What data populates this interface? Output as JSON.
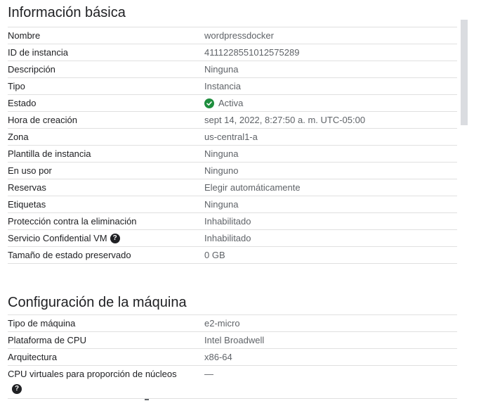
{
  "basic": {
    "title": "Información básica",
    "rows": [
      {
        "label": "Nombre",
        "value": "wordpressdocker"
      },
      {
        "label": "ID de instancia",
        "value": "4111228551012575289"
      },
      {
        "label": "Descripción",
        "value": "Ninguna"
      },
      {
        "label": "Tipo",
        "value": "Instancia"
      },
      {
        "label": "Estado",
        "value": "Activa"
      },
      {
        "label": "Hora de creación",
        "value": "sept 14, 2022, 8:27:50 a. m. UTC-05:00"
      },
      {
        "label": "Zona",
        "value": "us-central1-a"
      },
      {
        "label": "Plantilla de instancia",
        "value": "Ninguna"
      },
      {
        "label": "En uso por",
        "value": "Ninguno"
      },
      {
        "label": "Reservas",
        "value": "Elegir automáticamente"
      },
      {
        "label": "Etiquetas",
        "value": "Ninguna"
      },
      {
        "label": "Protección contra la eliminación",
        "value": "Inhabilitado"
      },
      {
        "label": "Servicio Confidential VM",
        "value": "Inhabilitado"
      },
      {
        "label": "Tamaño de estado preservado",
        "value": "0 GB"
      }
    ]
  },
  "machine": {
    "title": "Configuración de la máquina",
    "rows": [
      {
        "label": "Tipo de máquina",
        "value": "e2-micro"
      },
      {
        "label": "Plataforma de CPU",
        "value": "Intel Broadwell"
      },
      {
        "label": "Arquitectura",
        "value": "x86-64"
      },
      {
        "label": "CPU virtuales para proporción de núcleos",
        "value": "—"
      }
    ]
  },
  "icons": {
    "help": "?",
    "status": "check-circle-icon",
    "status_color": "#1e8e3e"
  }
}
